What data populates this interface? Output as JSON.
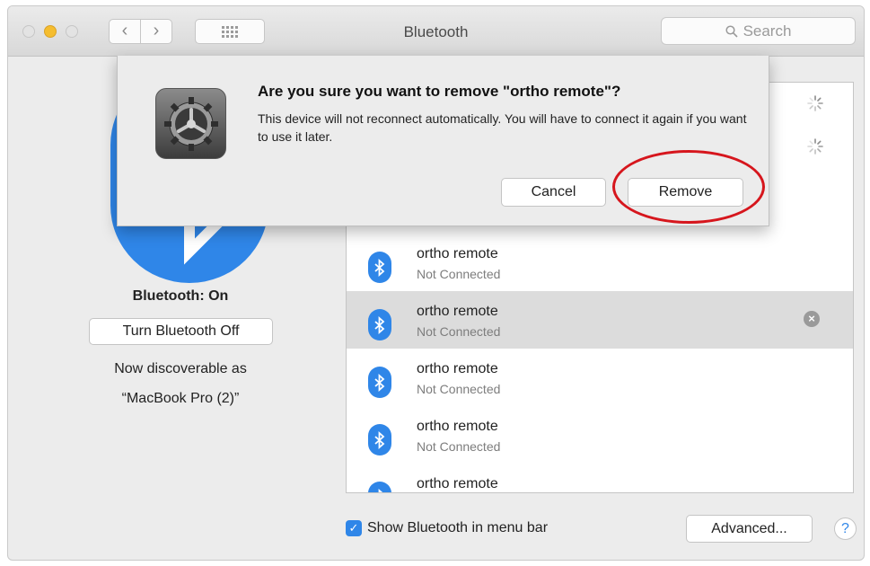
{
  "window": {
    "title": "Bluetooth"
  },
  "toolbar": {
    "back_glyph": "‹",
    "forward_glyph": "›",
    "search_placeholder": "Search"
  },
  "left_panel": {
    "status": "Bluetooth: On",
    "toggle_label": "Turn Bluetooth Off",
    "discoverable_label": "Now discoverable as",
    "machine_name": "“MacBook Pro (2)”"
  },
  "devices": [
    {
      "name": "ortho remote",
      "status": "Not Connected"
    },
    {
      "name": "ortho remote",
      "status": "Not Connected",
      "selected": true
    },
    {
      "name": "ortho remote",
      "status": "Not Connected"
    },
    {
      "name": "ortho remote",
      "status": "Not Connected"
    },
    {
      "name": "ortho remote",
      "status": ""
    }
  ],
  "footer": {
    "show_in_menu_bar_label": "Show Bluetooth in menu bar",
    "show_in_menu_bar_checked": true,
    "advanced_label": "Advanced...",
    "help_label": "?"
  },
  "dialog": {
    "title": "Are you sure you want to remove \"ortho remote\"?",
    "message": "This device will not reconnect automatically. You will have to connect it again if you want to use it later.",
    "cancel_label": "Cancel",
    "remove_label": "Remove",
    "highlight_color": "#d6161d"
  },
  "icons": {
    "bluetooth": "bluetooth-icon",
    "gear": "system-preferences-gear-icon",
    "spinner": "loading-spinner-icon",
    "remove": "remove-device-icon",
    "search": "search-icon"
  },
  "colors": {
    "accent": "#2f86e8",
    "window_bg": "#ececec"
  }
}
